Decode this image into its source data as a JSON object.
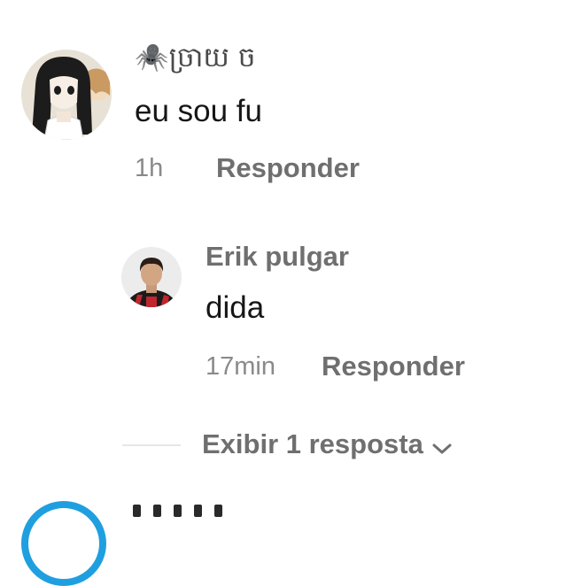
{
  "comments": [
    {
      "username": "🕷️ច្រាយ ច",
      "text": "eu sou fu",
      "time": "1h",
      "reply_label": "Responder"
    }
  ],
  "replies": [
    {
      "username": "Erik pulgar",
      "text": "dida",
      "time": "17min",
      "reply_label": "Responder"
    }
  ],
  "thread": {
    "show_more_label": "Exibir 1 resposta"
  },
  "colors": {
    "text_primary": "#161616",
    "text_secondary": "#6f6f6f",
    "time": "#8a8a8a",
    "next_avatar_ring": "#1f9fe0"
  },
  "icons": {
    "spider": "spider-icon",
    "chevron": "chevron-down-icon"
  }
}
